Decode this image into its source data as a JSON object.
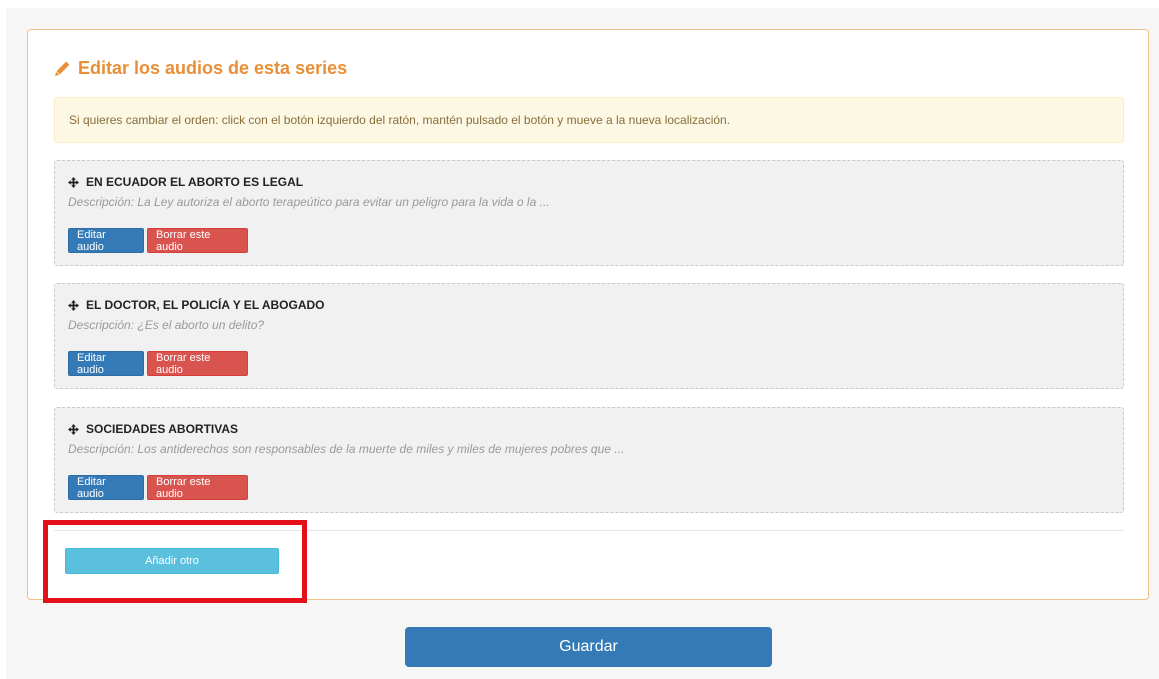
{
  "panel": {
    "title": "Editar los audios de esta series",
    "accent_color": "#e98f36",
    "title_icon": "pencil-icon"
  },
  "alert": {
    "text": "Si quieres cambiar el orden: click con el botón izquierdo del ratón, mantén pulsado el botón y mueve a la nueva localización."
  },
  "audios": [
    {
      "title": "EN ECUADOR EL ABORTO ES LEGAL",
      "description": "Descripción: La Ley autoriza el aborto terapeútico para evitar un peligro para la vida o la ...",
      "edit_label": "Editar audio",
      "delete_label": "Borrar este audio",
      "drag_icon": "move-icon"
    },
    {
      "title": "EL DOCTOR, EL POLICÍA Y EL ABOGADO",
      "description": "Descripción: ¿Es el aborto un delito?",
      "edit_label": "Editar audio",
      "delete_label": "Borrar este audio",
      "drag_icon": "move-icon"
    },
    {
      "title": "SOCIEDADES ABORTIVAS",
      "description": "Descripción: Los antiderechos son responsables de la muerte de miles y miles de mujeres pobres que ...",
      "edit_label": "Editar audio",
      "delete_label": "Borrar este audio",
      "drag_icon": "move-icon"
    }
  ],
  "add_button": {
    "label": "Añadir otro"
  },
  "save_button": {
    "label": "Guardar"
  },
  "colors": {
    "primary": "#337ab7",
    "danger": "#d9534f",
    "info": "#5bc0de",
    "highlight": "#e3101a"
  }
}
